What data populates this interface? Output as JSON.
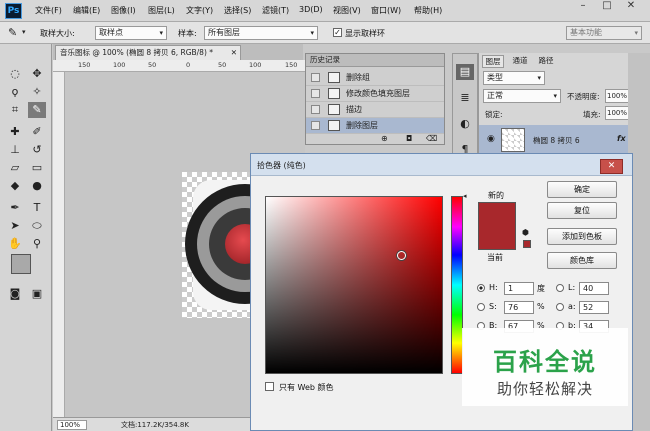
{
  "app": {
    "logo": "Ps"
  },
  "menu": [
    "文件(F)",
    "编辑(E)",
    "图像(I)",
    "图层(L)",
    "文字(Y)",
    "选择(S)",
    "滤镜(T)",
    "3D(D)",
    "视图(V)",
    "窗口(W)",
    "帮助(H)"
  ],
  "window_controls": {
    "minimize": "–",
    "restore": "□",
    "close": "✕"
  },
  "options": {
    "sample_size_label": "取样大小:",
    "sample_size_value": "取样点",
    "sample_label": "样本:",
    "sample_value": "所有图层",
    "show_ring_label": "显示取样环",
    "workspace_value": "基本功能"
  },
  "document": {
    "tab_title": "音乐图标 @ 100% (椭圆 8 拷贝 6, RGB/8) *",
    "ruler_ticks": [
      "150",
      "100",
      "50",
      "0",
      "50",
      "100",
      "150"
    ],
    "zoom": "100%",
    "doc_info": "文档:117.2K/354.8K"
  },
  "history": {
    "title": "历史记录",
    "items": [
      "删除组",
      "修改颜色填充图层",
      "描边",
      "删除图层"
    ]
  },
  "layers": {
    "tabs": [
      "图层",
      "通道",
      "路径"
    ],
    "kind_label": "类型",
    "blend_mode": "正常",
    "opacity_label": "不透明度:",
    "opacity_value": "100%",
    "lock_label": "锁定:",
    "fill_label": "填充:",
    "fill_value": "100%",
    "layer_name": "椭圆 8 拷贝 6",
    "fx_label": "fx"
  },
  "color_picker": {
    "title": "拾色器 (纯色)",
    "new_label": "新的",
    "current_label": "当前",
    "new_color": "#a8282c",
    "current_color": "#a8282c",
    "ok": "确定",
    "reset": "复位",
    "add_to_swatches": "添加到色板",
    "color_libraries": "颜色库",
    "only_web_colors": "只有 Web 颜色",
    "fields": [
      {
        "label": "H:",
        "value": "1",
        "unit": "度",
        "checked": true
      },
      {
        "label": "S:",
        "value": "76",
        "unit": "%",
        "checked": false
      },
      {
        "label": "B:",
        "value": "67",
        "unit": "%",
        "checked": false
      }
    ],
    "lab_fields": [
      {
        "label": "L:",
        "value": "40"
      },
      {
        "label": "a:",
        "value": "52"
      },
      {
        "label": "b:",
        "value": "34"
      }
    ]
  },
  "watermark": {
    "title": "百科全说",
    "subtitle": "助你轻松解决"
  }
}
